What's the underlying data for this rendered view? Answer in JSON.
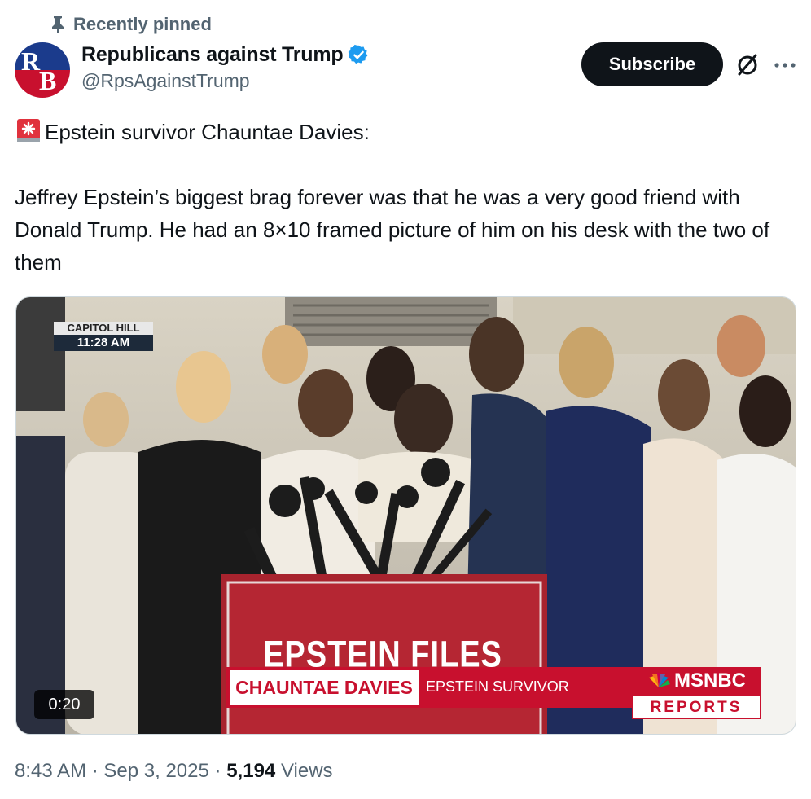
{
  "pinned": {
    "label": "Recently pinned",
    "icon": "pin-icon"
  },
  "author": {
    "display_name": "Republicans against Trump",
    "handle": "@RpsAgainstTrump",
    "avatar_letters": "RB",
    "verified_icon": "verified-badge-icon"
  },
  "actions": {
    "subscribe_label": "Subscribe",
    "grok_icon": "grok-icon",
    "more_icon": "more-icon"
  },
  "tweet": {
    "emoji": "siren-emoji-icon",
    "headline": "Epstein survivor Chauntae Davies:",
    "body": "Jeffrey Epstein’s biggest brag forever was that he was a very good friend with Donald Trump. He had an 8×10 framed picture of him on his desk with the two of them"
  },
  "video": {
    "location_top": "CAPITOL HILL",
    "location_time": "11:28 AM",
    "podium_sign": "EPSTEIN FILES",
    "chyron_name": "CHAUNTAE DAVIES",
    "chyron_title": "EPSTEIN SURVIVOR",
    "network": "MSNBC",
    "network_show": "REPORTS",
    "duration": "0:20"
  },
  "meta": {
    "time": "8:43 AM",
    "separator": "·",
    "date": "Sep 3, 2025",
    "views_count": "5,194",
    "views_label": "Views"
  },
  "colors": {
    "accent_blue": "#1d9bf0",
    "msnbc_red": "#c8102e",
    "text_secondary": "#536471"
  }
}
